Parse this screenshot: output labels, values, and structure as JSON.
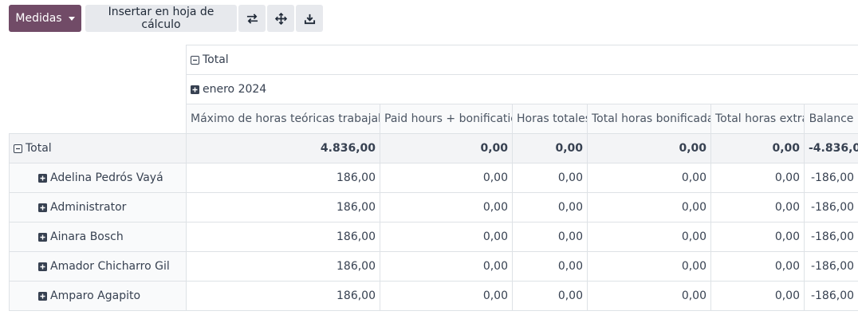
{
  "toolbar": {
    "measures_label": "Medidas",
    "insert_label": "Insertar en hoja de cálculo",
    "icons": [
      "flip-axis-icon",
      "expand-all-icon",
      "download-icon"
    ]
  },
  "pivot": {
    "col_total_label": "Total",
    "col_group_label": "enero 2024",
    "measures": [
      "Máximo de horas teóricas trabajables",
      "Paid hours + bonification",
      "Horas totales",
      "Total horas bonificadas",
      "Total horas extra",
      "Balance"
    ],
    "total_row": {
      "label": "Total",
      "values": [
        "4.836,00",
        "0,00",
        "0,00",
        "0,00",
        "0,00",
        "-4.836,00"
      ]
    },
    "rows": [
      {
        "label": "Adelina Pedrós Vayá",
        "values": [
          "186,00",
          "0,00",
          "0,00",
          "0,00",
          "0,00",
          "-186,00"
        ]
      },
      {
        "label": "Administrator",
        "values": [
          "186,00",
          "0,00",
          "0,00",
          "0,00",
          "0,00",
          "-186,00"
        ]
      },
      {
        "label": "Ainara Bosch",
        "values": [
          "186,00",
          "0,00",
          "0,00",
          "0,00",
          "0,00",
          "-186,00"
        ]
      },
      {
        "label": "Amador Chicharro Gil",
        "values": [
          "186,00",
          "0,00",
          "0,00",
          "0,00",
          "0,00",
          "-186,00"
        ]
      },
      {
        "label": "Amparo Agapito",
        "values": [
          "186,00",
          "0,00",
          "0,00",
          "0,00",
          "0,00",
          "-186,00"
        ]
      }
    ]
  }
}
